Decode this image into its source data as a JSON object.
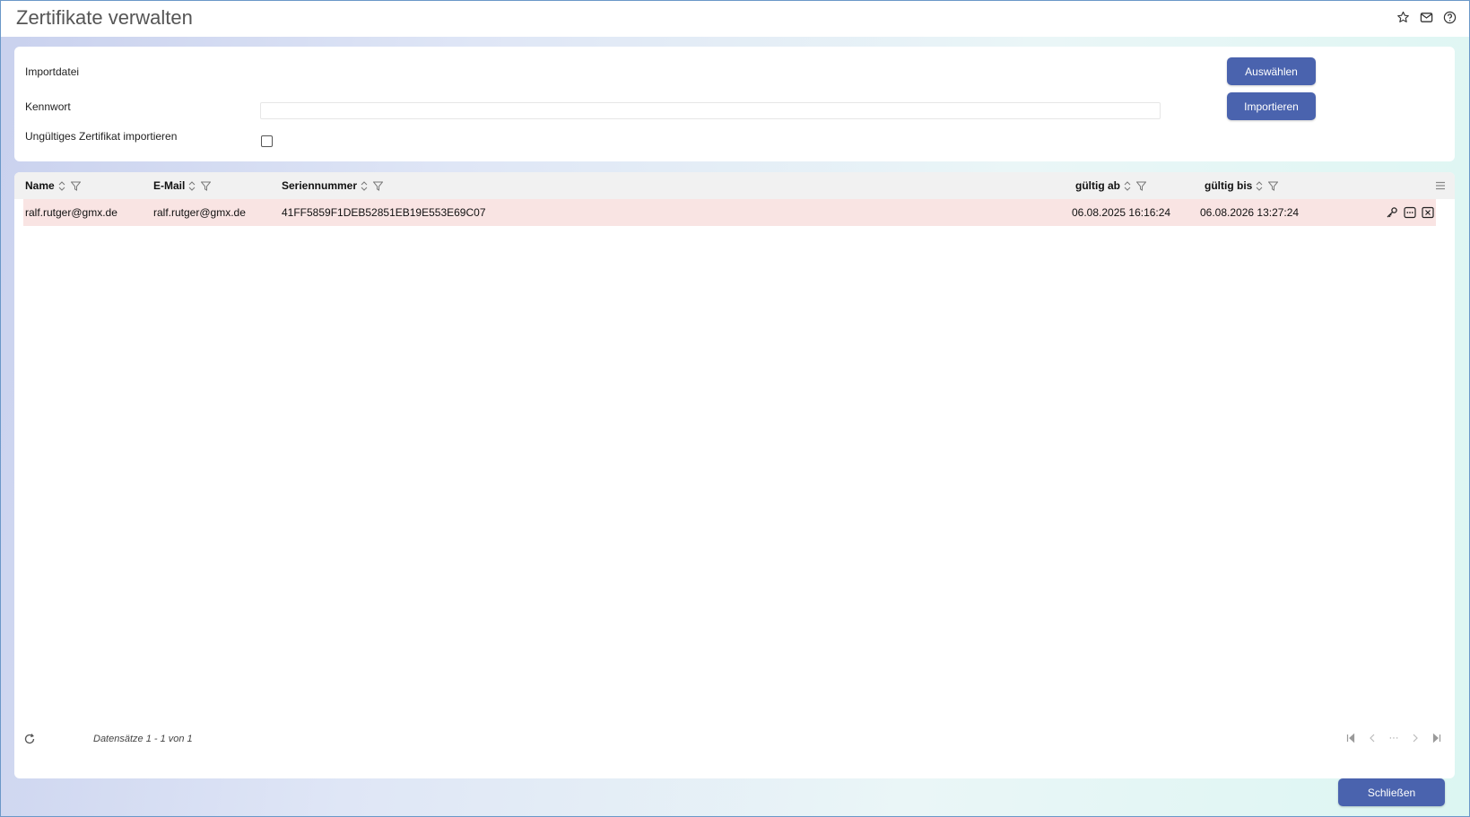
{
  "window": {
    "title": "Zertifikate verwalten"
  },
  "top_icons": [
    "star-icon",
    "mail-icon",
    "help-icon"
  ],
  "form": {
    "import_file_label": "Importdatei",
    "password_label": "Kennwort",
    "password_value": "",
    "invalid_cert_label": "Ungültiges Zertifikat importieren",
    "invalid_cert_checked": false,
    "select_button": "Auswählen",
    "import_button": "Importieren"
  },
  "grid": {
    "columns": [
      "Name",
      "E-Mail",
      "Seriennummer",
      "gültig ab",
      "gültig bis"
    ],
    "rows": [
      {
        "name": "ralf.rutger@gmx.de",
        "email": "ralf.rutger@gmx.de",
        "serial": "41FF5859F1DEB52851EB19E553E69C07",
        "valid_from": "06.08.2025 16:16:24",
        "valid_to": "06.08.2026 13:27:24"
      }
    ],
    "row_actions": [
      "key-icon",
      "more-icon",
      "delete-icon"
    ],
    "footer_info": "Datensätze 1 - 1 von 1",
    "pager_ellipsis": "···"
  },
  "colors": {
    "accent": "#4a63ae",
    "row_highlight": "#f9e4e3",
    "header_bg": "#f1f1f1"
  },
  "close_button": "Schließen"
}
